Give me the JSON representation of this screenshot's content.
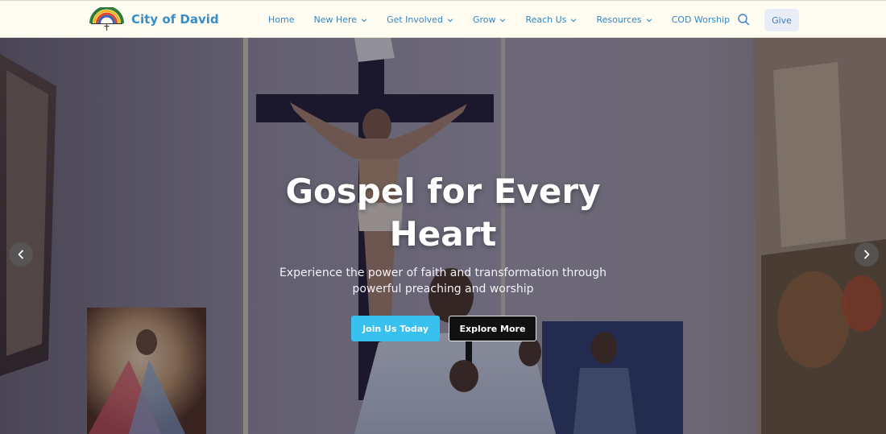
{
  "header": {
    "brand_name": "City of David",
    "nav": [
      {
        "label": "Home",
        "has_dropdown": false
      },
      {
        "label": "New Here",
        "has_dropdown": true
      },
      {
        "label": "Get Involved",
        "has_dropdown": true
      },
      {
        "label": "Grow",
        "has_dropdown": true
      },
      {
        "label": "Reach Us",
        "has_dropdown": true
      },
      {
        "label": "Resources",
        "has_dropdown": true
      },
      {
        "label": "COD Worship",
        "has_dropdown": false
      }
    ],
    "search_icon": "search-icon",
    "give_label": "Give"
  },
  "hero": {
    "title": "Gospel for Every Heart",
    "subtitle": "Experience the power of faith and transformation through powerful preaching and worship",
    "primary_button": "Join Us Today",
    "secondary_button": "Explore More",
    "prev_icon": "chevron-left-icon",
    "next_icon": "chevron-right-icon"
  },
  "colors": {
    "header_bg": "#fffdf2",
    "brand": "#3b8dc8",
    "nav_link": "#2f86c7",
    "primary_button": "#38c0ef",
    "secondary_button": "#111111"
  }
}
